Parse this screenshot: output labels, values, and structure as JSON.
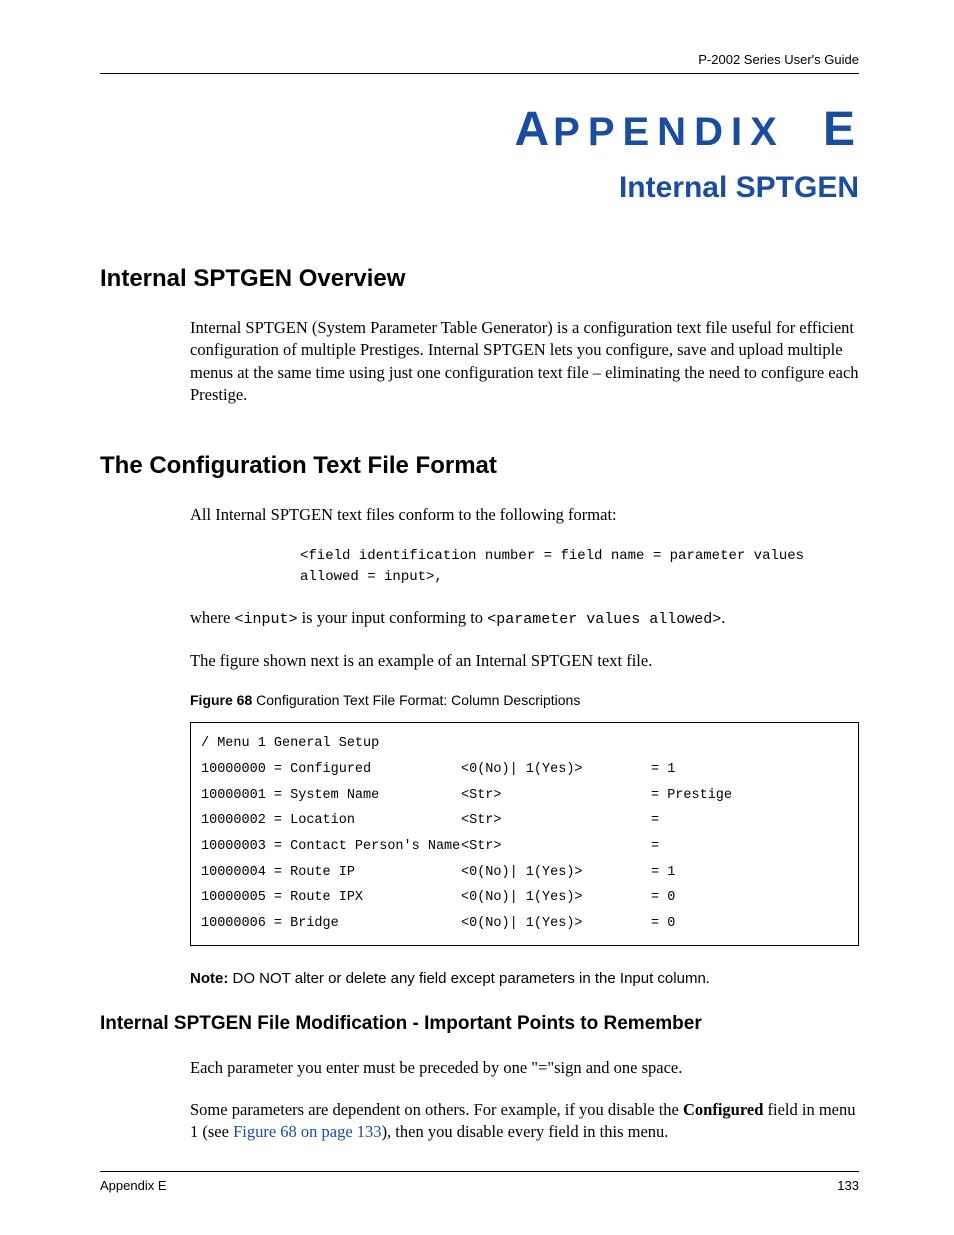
{
  "header": {
    "right": "P-2002 Series User's Guide"
  },
  "title": {
    "prefix_big_a": "A",
    "prefix_rest": "PPENDIX",
    "suffix_big": "E",
    "subtitle": "Internal SPTGEN"
  },
  "section1": {
    "heading": "Internal SPTGEN Overview",
    "para": "Internal SPTGEN (System Parameter Table Generator) is a configuration text file useful for efficient configuration of multiple Prestiges. Internal SPTGEN lets you configure, save and upload multiple menus at the same time using just one configuration text file – eliminating the need to configure each Prestige."
  },
  "section2": {
    "heading": "The Configuration Text File Format",
    "para1": "All Internal SPTGEN text files conform to the following format:",
    "code_block": "<field identification number = field name = parameter values allowed = input>,",
    "para2_a": "where ",
    "para2_mono1": "<input>",
    "para2_b": " is your input conforming to ",
    "para2_mono2": "<parameter values allowed>",
    "para2_c": ".",
    "para3": "The figure shown next is an example of an Internal SPTGEN text file.",
    "figure_label": "Figure 68",
    "figure_caption": "   Configuration Text File Format: Column Descriptions",
    "table": {
      "header_line": "/ Menu 1 General Setup",
      "rows": [
        {
          "a": " 10000000 = Configured",
          "b": "<0(No)| 1(Yes)>",
          "c": "  = 1"
        },
        {
          "a": " 10000001 = System Name",
          "b": "<Str>",
          "c": "  = Prestige"
        },
        {
          "a": " 10000002 = Location",
          "b": "<Str>",
          "c": "  ="
        },
        {
          "a": " 10000003 = Contact Person's Name",
          "b": "<Str>",
          "c": "  ="
        },
        {
          "a": " 10000004 = Route IP",
          "b": "<0(No)| 1(Yes)>",
          "c": "  = 1"
        },
        {
          "a": " 10000005 = Route IPX",
          "b": "<0(No)| 1(Yes)>",
          "c": "= 0"
        },
        {
          "a": " 10000006 = Bridge",
          "b": "<0(No)| 1(Yes)>",
          "c": "= 0"
        }
      ]
    },
    "note_label": "Note: ",
    "note_text": "DO NOT alter or delete any field except parameters in the Input column."
  },
  "section3": {
    "heading": "Internal SPTGEN File Modification - Important Points to Remember",
    "para1": "Each parameter you enter must be preceded by one \"=\"sign and one space.",
    "para2_a": "Some parameters are dependent on others. For example, if you disable the ",
    "para2_bold": "Configured",
    "para2_b": " field in menu 1 (see ",
    "para2_link": "Figure 68 on page 133",
    "para2_c": "), then you disable every field in this menu."
  },
  "footer": {
    "left": "Appendix E",
    "right": "133"
  }
}
